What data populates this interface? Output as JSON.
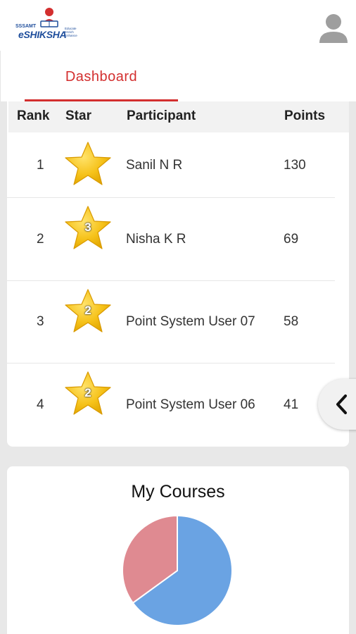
{
  "header": {
    "logo": {
      "small": "SSSAMT",
      "main": "eSHIKSHA",
      "tagline": "Educate Enrich Enhance"
    },
    "avatar_icon": "user-avatar-icon"
  },
  "tabs": [
    {
      "label": "Dashboard",
      "active": true
    }
  ],
  "leaderboard": {
    "columns": [
      "Rank",
      "Star",
      "Participant",
      "Points"
    ],
    "rows": [
      {
        "rank": "1",
        "star_badge": "",
        "participant": "Sanil N R",
        "points": "130"
      },
      {
        "rank": "2",
        "star_badge": "3",
        "participant": "Nisha K R",
        "points": "69"
      },
      {
        "rank": "3",
        "star_badge": "2",
        "participant": "Point System User 07",
        "points": "58"
      },
      {
        "rank": "4",
        "star_badge": "2",
        "participant": "Point System User 06",
        "points": "41"
      }
    ]
  },
  "side_toggle": {
    "icon": "chevron-left-icon"
  },
  "courses": {
    "title": "My Courses",
    "chart_data": {
      "type": "pie",
      "title": "",
      "slices": [
        {
          "value": 0.65,
          "color": "#6aa3e3"
        },
        {
          "value": 0.35,
          "color": "#df8a91"
        }
      ]
    }
  },
  "colors": {
    "accent": "#d32f2f",
    "star": "#f5c518",
    "pie_blue": "#6aa3e3",
    "pie_red": "#df8a91"
  }
}
